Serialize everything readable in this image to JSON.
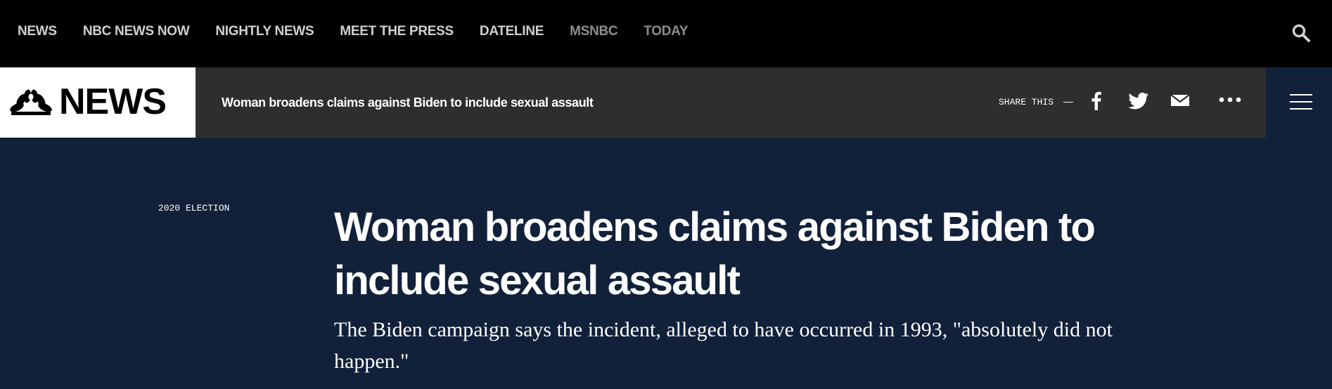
{
  "top_nav": {
    "links": [
      {
        "label": "NEWS"
      },
      {
        "label": "NBC NEWS NOW"
      },
      {
        "label": "NIGHTLY NEWS"
      },
      {
        "label": "MEET THE PRESS"
      },
      {
        "label": "DATELINE"
      },
      {
        "label": "MSNBC"
      },
      {
        "label": "TODAY"
      }
    ],
    "search_icon": "search-icon"
  },
  "sticky_bar": {
    "logo_text": "NEWS",
    "logo_icon": "peacock-icon",
    "headline": "Woman broadens claims against Biden to include sexual assault",
    "share_label": "SHARE THIS",
    "share_dash": "—",
    "share_icons": [
      "facebook-icon",
      "twitter-icon",
      "mail-icon",
      "more-icon"
    ],
    "menu_icon": "hamburger-icon"
  },
  "article": {
    "eyebrow": "2020 ELECTION",
    "headline": "Woman broadens claims against Biden to include sexual assault",
    "dek": "The Biden campaign says the incident, alleged to have occurred in 1993, \"absolutely did not happen.\""
  },
  "colors": {
    "top_nav_bg": "#000000",
    "sticky_bar_bg": "#2e2e2e",
    "hero_bg": "#12213a",
    "text": "#ffffff",
    "nav_dim": "#8e8e8e"
  }
}
